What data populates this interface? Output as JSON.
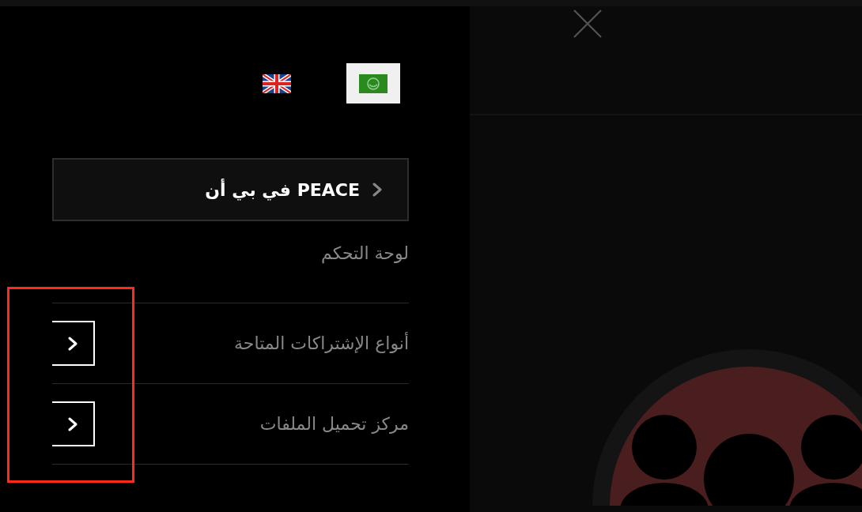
{
  "languages": [
    {
      "kind": "uk",
      "selected": false
    },
    {
      "kind": "arabic",
      "selected": true
    }
  ],
  "menu": [
    {
      "kind": "boxed",
      "label": "PEACE في بي أن"
    },
    {
      "kind": "plain",
      "label": "لوحة التحكم"
    },
    {
      "kind": "expandable",
      "label": "أنواع الإشتراكات المتاحة"
    },
    {
      "kind": "expandable",
      "label": "مركز تحميل الملفات"
    }
  ],
  "annotation": {
    "shown": true
  }
}
